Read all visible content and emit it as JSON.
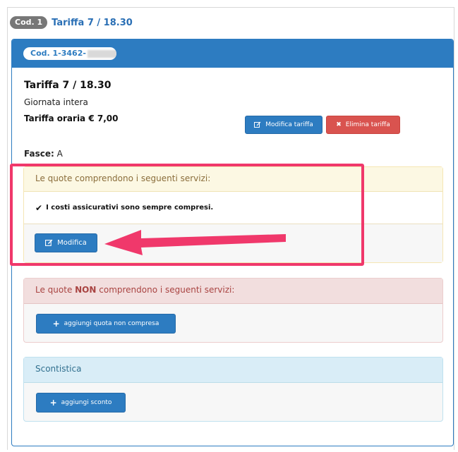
{
  "header": {
    "badge": "Cod. 1",
    "title": "Tariffa 7 / 18.30"
  },
  "card": {
    "code_label": "Cod. 1-3462-",
    "tariff_title": "Tariffa 7 / 18.30",
    "tariff_subtitle": "Giornata intera",
    "tariff_rate": "Tariffa oraria € 7,00",
    "edit_tariff_label": "Modifica tariffa",
    "delete_tariff_label": "Elimina tariffa",
    "fasce_label": "Fasce:",
    "fasce_value": "A"
  },
  "included": {
    "heading": "Le quote comprendono i seguenti servizi:",
    "items": [
      {
        "text": "I costi assicurativi sono sempre compresi."
      }
    ],
    "edit_label": "Modifica"
  },
  "not_included": {
    "heading_pre": "Le quote ",
    "heading_bold": "NON",
    "heading_post": " comprendono i seguenti servizi:",
    "add_label": "aggiungi quota non compresa"
  },
  "discount": {
    "heading": "Scontistica",
    "add_label": "aggiungi sconto"
  },
  "colors": {
    "primary": "#2d7cc1",
    "danger": "#d9534f",
    "highlight": "#f0386b"
  }
}
